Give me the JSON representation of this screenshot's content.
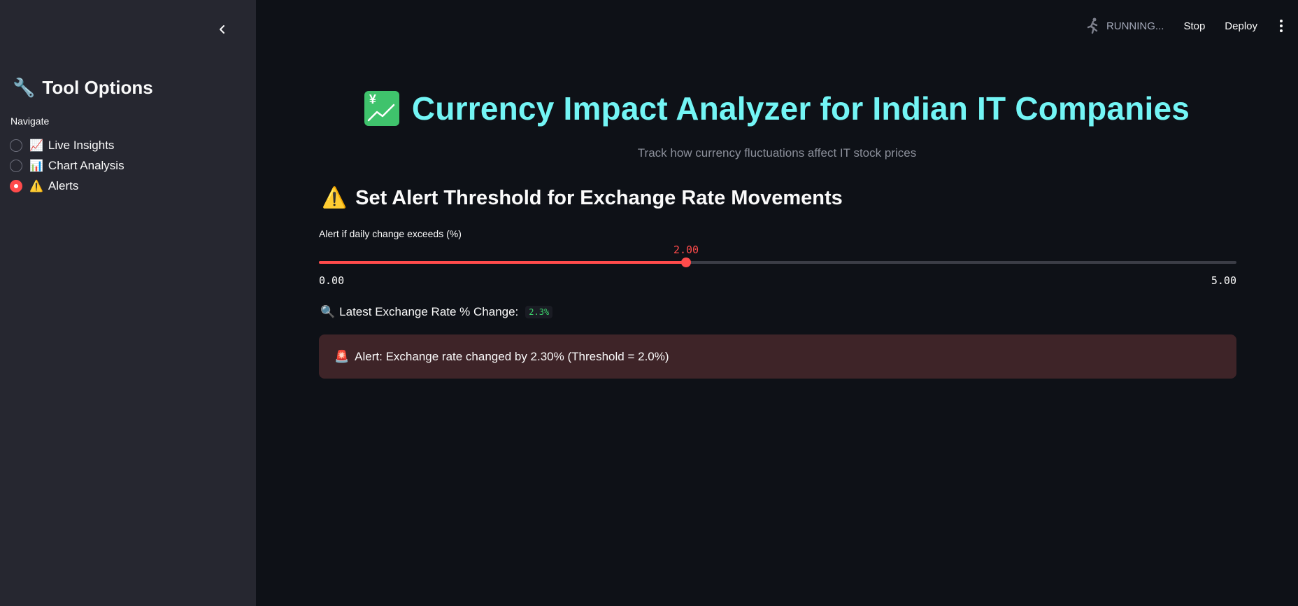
{
  "header": {
    "status": "RUNNING...",
    "stop_label": "Stop",
    "deploy_label": "Deploy"
  },
  "sidebar": {
    "title_emoji": "🔧",
    "title": "Tool Options",
    "nav_label": "Navigate",
    "items": [
      {
        "emoji": "📈",
        "label": "Live Insights",
        "selected": false
      },
      {
        "emoji": "📊",
        "label": "Chart Analysis",
        "selected": false
      },
      {
        "emoji": "⚠️",
        "label": "Alerts",
        "selected": true
      }
    ]
  },
  "main": {
    "title": "Currency Impact Analyzer for Indian IT Companies",
    "title_icon_glyph": "¥",
    "subtitle": "Track how currency fluctuations affect IT stock prices",
    "section_emoji": "⚠️",
    "section_title": "Set Alert Threshold for Exchange Rate Movements",
    "slider": {
      "label": "Alert if daily change exceeds (%)",
      "value": 2.0,
      "value_text": "2.00",
      "min": 0,
      "max": 5,
      "min_text": "0.00",
      "max_text": "5.00"
    },
    "metric": {
      "emoji": "🔍",
      "label": "Latest Exchange Rate % Change:",
      "value": "2.3%"
    },
    "alert": {
      "emoji": "🚨",
      "text": "Alert: Exchange rate changed by 2.30% (Threshold = 2.0%)"
    }
  },
  "colors": {
    "accent": "#ff4b4b",
    "title": "#73f5f5",
    "sidebar_bg": "#262730",
    "main_bg": "#0e1117",
    "alert_bg": "#3e2428",
    "metric_value": "#3dd56d"
  }
}
